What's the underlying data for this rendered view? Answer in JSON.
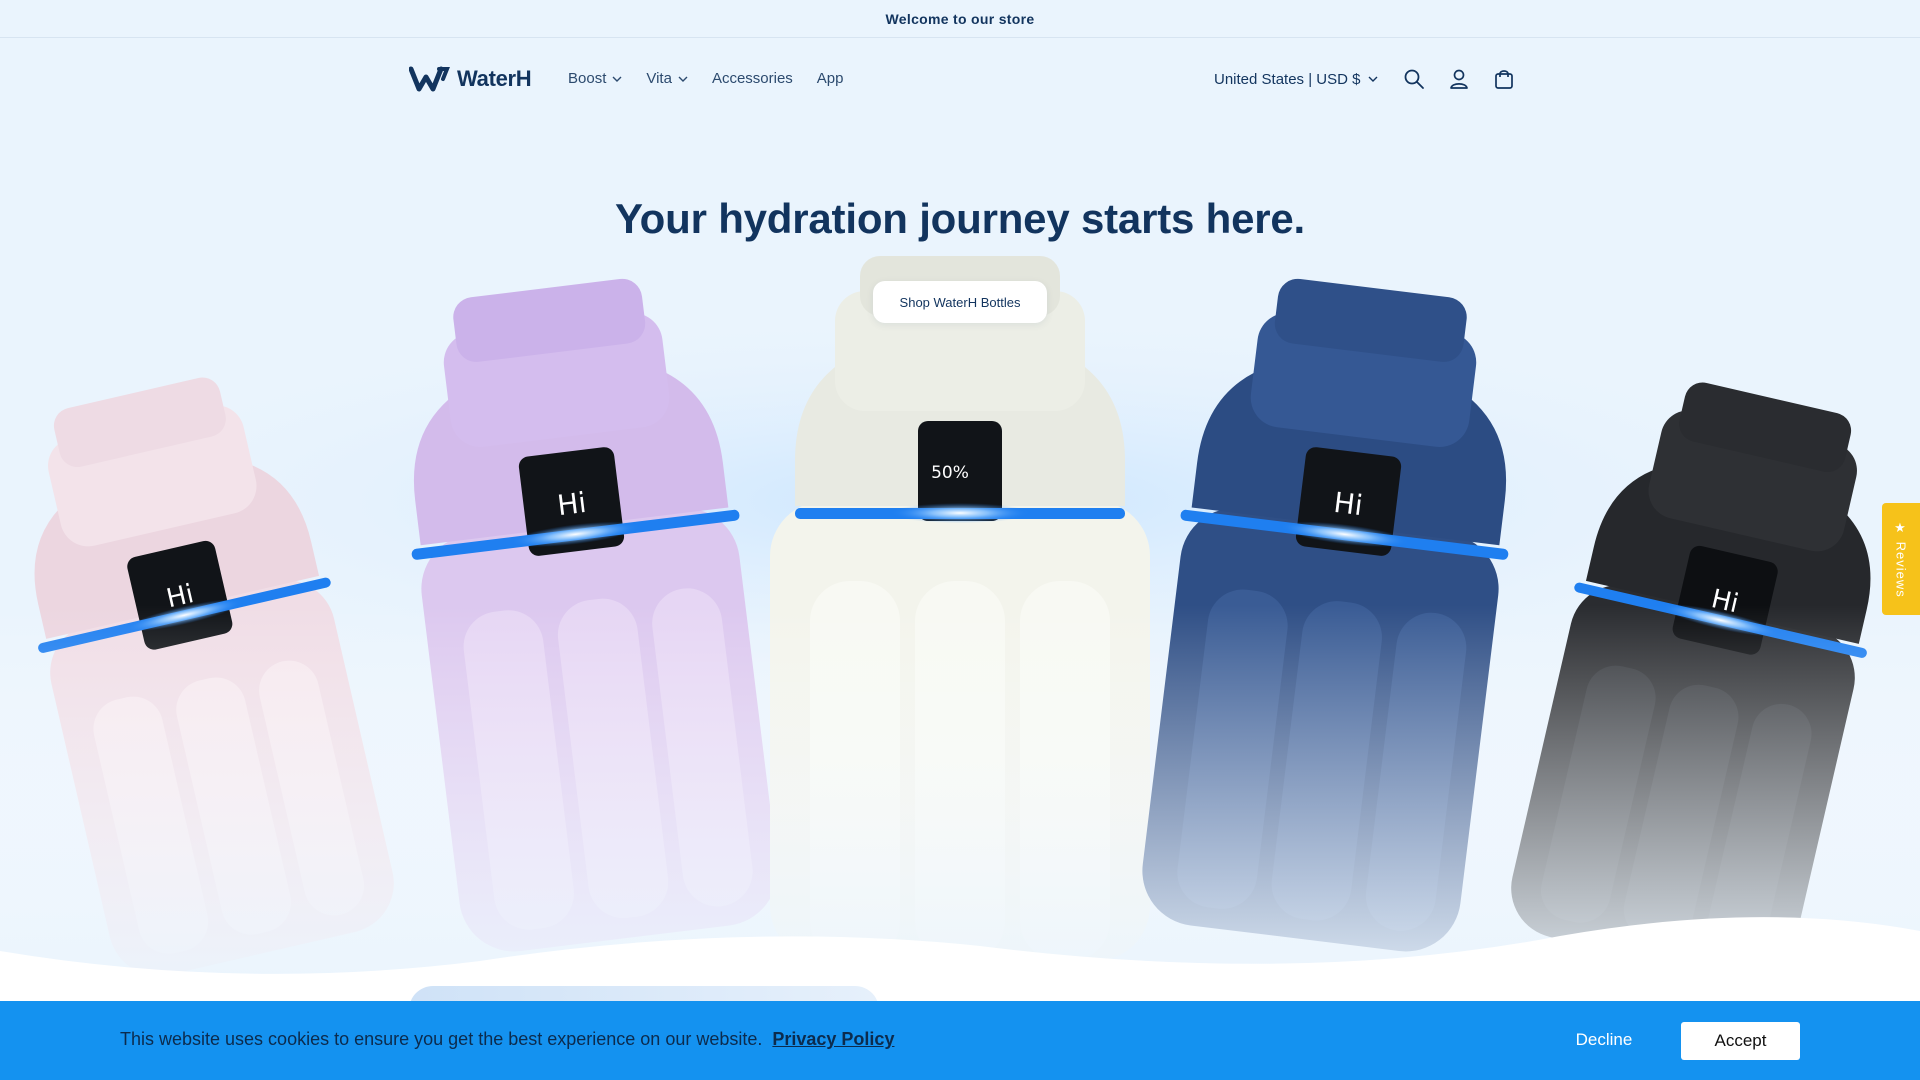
{
  "announcement": {
    "text": "Welcome to our store"
  },
  "header": {
    "logo_text": "WaterH",
    "nav": [
      {
        "label": "Boost",
        "has_dropdown": true
      },
      {
        "label": "Vita",
        "has_dropdown": true
      },
      {
        "label": "Accessories",
        "has_dropdown": false
      },
      {
        "label": "App",
        "has_dropdown": false
      }
    ],
    "locale": "United States | USD $",
    "icons": [
      "search-icon",
      "account-icon",
      "cart-icon"
    ]
  },
  "hero": {
    "title": "Your hydration journey starts here.",
    "button_label": "Shop WaterH Bottles",
    "bottles": [
      {
        "color_name": "pink",
        "body": "#f0dde6",
        "cap": "#f3e3ea",
        "screen_text": "Hi"
      },
      {
        "color_name": "lavender",
        "body": "#dcc8ef",
        "cap": "#d4bdee",
        "screen_text": "Hi"
      },
      {
        "color_name": "white",
        "body": "#f3f4ec",
        "cap": "#eceee6",
        "screen_text": "50%"
      },
      {
        "color_name": "navy",
        "body": "#2f4f86",
        "cap": "#355894",
        "screen_text": "Hi"
      },
      {
        "color_name": "black",
        "body": "#2a2c30",
        "cap": "#2e3034",
        "screen_text": "Hi"
      }
    ],
    "glow_color": "#1f7ff0"
  },
  "reviews_tab": {
    "label": "★ Reviews",
    "color": "#f6c21a"
  },
  "cookie_banner": {
    "text": "This website uses cookies to ensure you get the best experience on our website.",
    "link_label": "Privacy Policy",
    "decline_label": "Decline",
    "accept_label": "Accept",
    "background": "#1492f0"
  },
  "colors": {
    "brand": "#12345e",
    "background": "#eaf4fd"
  }
}
